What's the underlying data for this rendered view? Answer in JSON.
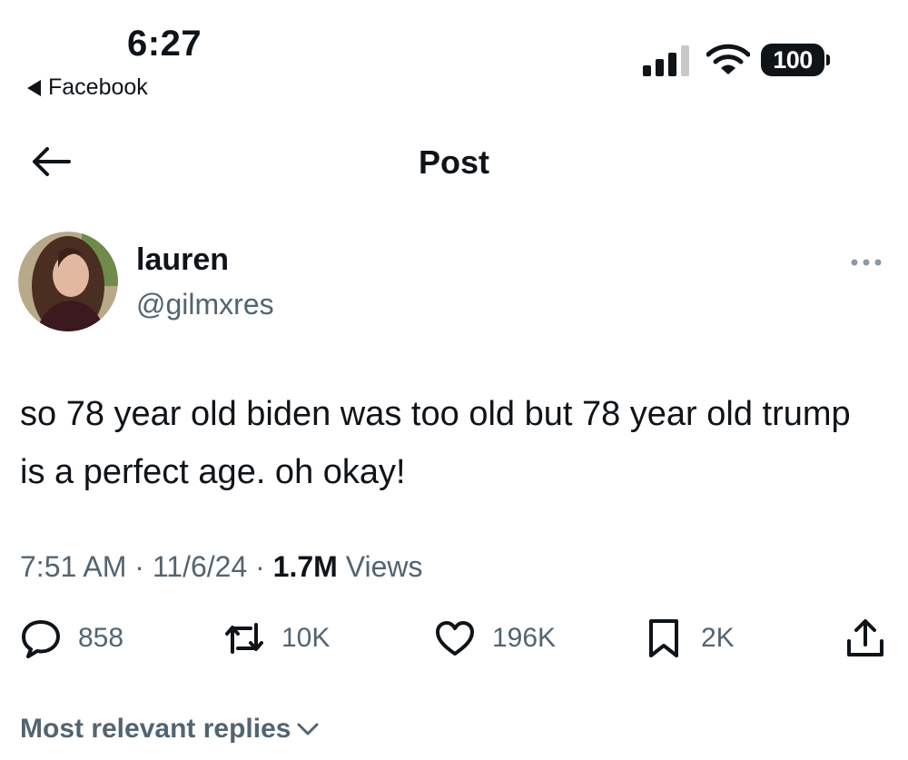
{
  "status_bar": {
    "time": "6:27",
    "back_app_label": "Facebook",
    "battery": "100"
  },
  "nav": {
    "title": "Post"
  },
  "post": {
    "author_name": "lauren",
    "author_handle": "@gilmxres",
    "text": "so 78 year old biden was too old but 78 year old trump is a perfect age. oh okay!",
    "time": "7:51 AM",
    "date": "11/6/24",
    "views_count": "1.7M",
    "views_label": "Views"
  },
  "actions": {
    "replies": "858",
    "reposts": "10K",
    "likes": "196K",
    "bookmarks": "2K"
  },
  "replies_sort_label": "Most relevant replies",
  "colors": {
    "text_primary": "#0f1419",
    "text_secondary": "#536471",
    "background": "#ffffff"
  }
}
